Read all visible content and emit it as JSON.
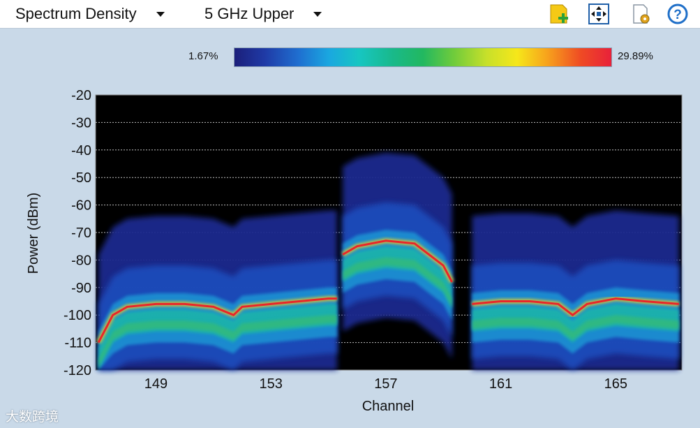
{
  "toolbar": {
    "view_select": "Spectrum Density",
    "band_select": "5 GHz Upper",
    "icons": [
      "add-icon",
      "fit-view-icon",
      "settings-page-icon",
      "help-icon"
    ]
  },
  "legend": {
    "min_label": "1.67%",
    "max_label": "29.89%",
    "colors": [
      "#1b1f7a",
      "#1f3aa6",
      "#1f6fd0",
      "#1aa7e0",
      "#17c6c2",
      "#19b98a",
      "#22b860",
      "#6ecb3c",
      "#c8e02a",
      "#f6e71a",
      "#f7a21c",
      "#ef4a24",
      "#e8213a"
    ]
  },
  "chart_data": {
    "type": "heatmap",
    "xlabel": "Channel",
    "ylabel": "Power (dBm)",
    "x_ticks": [
      149,
      153,
      157,
      161,
      165
    ],
    "y_ticks": [
      -20,
      -30,
      -40,
      -50,
      -60,
      -70,
      -80,
      -90,
      -100,
      -110,
      -120
    ],
    "xlim": [
      146.9,
      167.3
    ],
    "ylim": [
      -120,
      -20
    ],
    "grid": true,
    "color_range_percent": [
      1.67,
      29.89
    ],
    "background": "#000000",
    "series": [
      {
        "channel": [
          147.0,
          147.5,
          148.0,
          149.0,
          150.0,
          151.0,
          151.7,
          152.0,
          153.0,
          154.0,
          155.0,
          155.3
        ],
        "peak_power_dbm": [
          -110,
          -100,
          -97,
          -96,
          -96,
          -97,
          -100,
          -97,
          -96,
          -95,
          -94,
          -94
        ]
      },
      {
        "channel": [
          155.5,
          156.0,
          157.0,
          158.0,
          158.5,
          159.0,
          159.3
        ],
        "peak_power_dbm": [
          -78,
          -75,
          -73,
          -74,
          -78,
          -82,
          -88
        ]
      },
      {
        "channel": [
          160.0,
          161.0,
          162.0,
          163.0,
          163.5,
          164.0,
          165.0,
          166.0,
          167.2
        ],
        "peak_power_dbm": [
          -96,
          -95,
          -95,
          -96,
          -100,
          -96,
          -94,
          -95,
          -96
        ]
      }
    ],
    "spikes": [
      {
        "channel": 151.9,
        "top_dbm": -70
      },
      {
        "channel": 153.9,
        "top_dbm": -82
      },
      {
        "channel": 159.8,
        "top_dbm": -72
      },
      {
        "channel": 160.2,
        "top_dbm": -73
      },
      {
        "channel": 164.3,
        "top_dbm": -67
      },
      {
        "channel": 165.3,
        "top_dbm": -67
      }
    ]
  },
  "watermark": "大数跨境"
}
